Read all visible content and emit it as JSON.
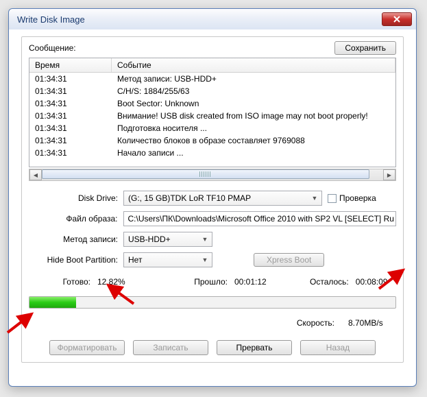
{
  "title": "Write Disk Image",
  "topbar": {
    "message_label": "Сообщение:",
    "save_label": "Сохранить"
  },
  "log": {
    "header_time": "Время",
    "header_event": "Событие",
    "rows": [
      {
        "time": "01:34:31",
        "event": "Метод записи: USB-HDD+"
      },
      {
        "time": "01:34:31",
        "event": "C/H/S: 1884/255/63"
      },
      {
        "time": "01:34:31",
        "event": "Boot Sector: Unknown"
      },
      {
        "time": "01:34:31",
        "event": "Внимание! USB disk created from ISO image may not boot properly!"
      },
      {
        "time": "01:34:31",
        "event": "Подготовка носителя ..."
      },
      {
        "time": "01:34:31",
        "event": "Количество блоков в образе составляет 9769088"
      },
      {
        "time": "01:34:31",
        "event": "Начало записи ..."
      }
    ]
  },
  "form": {
    "disk_drive_label": "Disk Drive:",
    "disk_drive_value": "(G:, 15 GB)TDK LoR TF10          PMAP",
    "verify_label": "Проверка",
    "image_file_label": "Файл образа:",
    "image_file_value": "C:\\Users\\ПК\\Downloads\\Microsoft Office 2010 with SP2 VL [SELECT] Ru",
    "write_method_label": "Метод записи:",
    "write_method_value": "USB-HDD+",
    "hide_boot_label": "Hide Boot Partition:",
    "hide_boot_value": "Нет",
    "xpress_label": "Xpress Boot"
  },
  "status": {
    "ready_label": "Готово:",
    "ready_value": "12.82%",
    "elapsed_label": "Прошло:",
    "elapsed_value": "00:01:12",
    "remain_label": "Осталось:",
    "remain_value": "00:08:09",
    "progress_percent": 12.82,
    "speed_label": "Скорость:",
    "speed_value": "8.70MB/s"
  },
  "buttons": {
    "format": "Форматировать",
    "write": "Записать",
    "abort": "Прервать",
    "back": "Назад"
  }
}
